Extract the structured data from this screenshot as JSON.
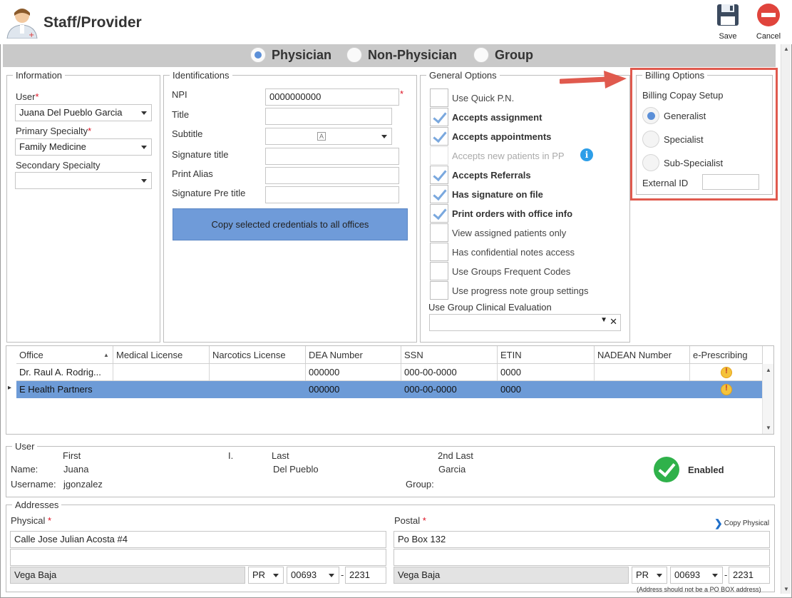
{
  "window": {
    "title": "Staff/Provider",
    "save_label": "Save",
    "cancel_label": "Cancel"
  },
  "provider_type": {
    "options": [
      "Physician",
      "Non-Physician",
      "Group"
    ],
    "selected": "Physician"
  },
  "information": {
    "legend": "Information",
    "user_label": "User",
    "user_value": "Juana Del Pueblo Garcia",
    "primary_label": "Primary Specialty",
    "primary_value": "Family Medicine",
    "secondary_label": "Secondary Specialty",
    "secondary_value": ""
  },
  "identifications": {
    "legend": "Identifications",
    "npi_label": "NPI",
    "npi_value": "0000000000",
    "title_label": "Title",
    "title_value": "",
    "subtitle_label": "Subtitle",
    "subtitle_value": "",
    "sigtitle_label": "Signature title",
    "sigtitle_value": "",
    "alias_label": "Print Alias",
    "alias_value": "",
    "sigpre_label": "Signature Pre title",
    "sigpre_value": "",
    "copy_button": "Copy selected credentials to all offices"
  },
  "general_options": {
    "legend": "General Options",
    "items": [
      {
        "label": "Use Quick P.N.",
        "checked": false
      },
      {
        "label": "Accepts assignment",
        "checked": true
      },
      {
        "label": "Accepts appointments",
        "checked": true
      },
      {
        "label": "Accepts new patients in PP",
        "checked": false,
        "disabled": true
      },
      {
        "label": "Accepts Referrals",
        "checked": true
      },
      {
        "label": "Has signature on file",
        "checked": true
      },
      {
        "label": "Print orders with office info",
        "checked": true
      },
      {
        "label": "View assigned patients only",
        "checked": false
      },
      {
        "label": "Has confidential notes access",
        "checked": false
      },
      {
        "label": "Use Groups Frequent Codes",
        "checked": false
      },
      {
        "label": "Use progress note group settings",
        "checked": false
      }
    ],
    "clinical_eval_label": "Use Group Clinical Evaluation",
    "clinical_eval_value": ""
  },
  "billing": {
    "legend": "Billing Options",
    "copay_label": "Billing Copay Setup",
    "options": [
      "Generalist",
      "Specialist",
      "Sub-Specialist"
    ],
    "selected": "Generalist",
    "external_id_label": "External ID",
    "external_id_value": "",
    "highlight_color": "#e05a4e"
  },
  "offices_grid": {
    "columns": [
      "Office",
      "Medical License",
      "Narcotics License",
      "DEA Number",
      "SSN",
      "ETIN",
      "NADEAN Number",
      "e-Prescribing"
    ],
    "rows": [
      [
        "Dr. Raul A. Rodrig...",
        "",
        "",
        "000000",
        "000-00-0000",
        "0000",
        "",
        ""
      ],
      [
        "E Health Partners",
        "",
        "",
        "000000",
        "000-00-0000",
        "0000",
        "",
        ""
      ]
    ],
    "selected_row": 1
  },
  "user_section": {
    "legend": "User",
    "first_header": "First",
    "initial_header": "I.",
    "last_header": "Last",
    "second_last_header": "2nd Last",
    "name_label": "Name:",
    "first": "Juana",
    "last": "Del Pueblo",
    "second_last": "Garcia",
    "username_label": "Username:",
    "username": "jgonzalez",
    "group_label": "Group:",
    "group": "",
    "status": "Enabled"
  },
  "addresses": {
    "legend": "Addresses",
    "physical_label": "Physical",
    "postal_label": "Postal",
    "copy_physical": "Copy Physical",
    "physical": {
      "line1": "Calle Jose Julian Acosta #4",
      "line2": "",
      "city": "Vega Baja",
      "state": "PR",
      "zip": "00693",
      "zip4": "2231"
    },
    "postal": {
      "line1": "Po Box 132",
      "line2": "",
      "city": "Vega Baja",
      "state": "PR",
      "zip": "00693",
      "zip4": "2231"
    },
    "note": "(Address should not be a PO BOX address)"
  }
}
